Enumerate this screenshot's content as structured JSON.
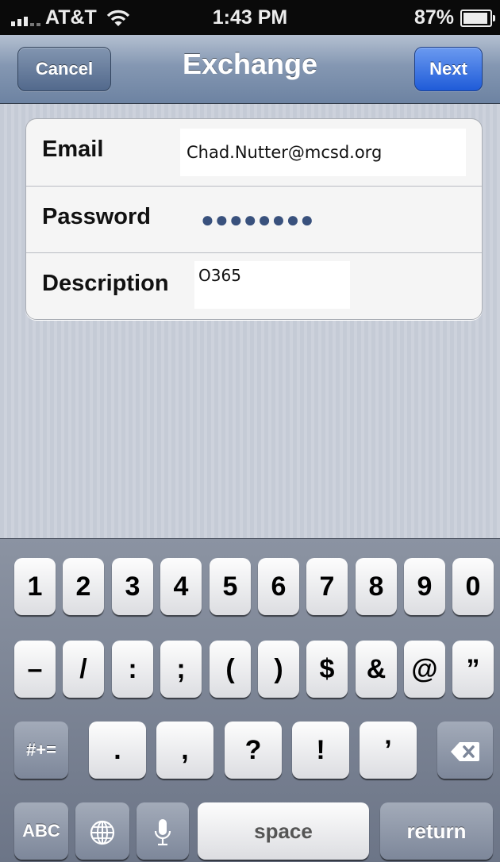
{
  "status_bar": {
    "carrier": "AT&T",
    "time": "1:43 PM",
    "battery_percent": "87%",
    "icons": [
      "signal-icon",
      "wifi-icon",
      "battery-icon"
    ]
  },
  "nav_bar": {
    "cancel_label": "Cancel",
    "title": "Exchange",
    "next_label": "Next"
  },
  "form": {
    "email_label": "Email",
    "email_value": "Chad.Nutter@mcsd.org",
    "password_label": "Password",
    "password_mask": "●●●●●●●●",
    "description_label": "Description",
    "description_value": "O365"
  },
  "keyboard": {
    "row1": [
      "1",
      "2",
      "3",
      "4",
      "5",
      "6",
      "7",
      "8",
      "9",
      "0"
    ],
    "row2": [
      "–",
      "/",
      ":",
      ";",
      "(",
      ")",
      "$",
      "&",
      "@",
      "”"
    ],
    "row3": {
      "shift_label": "#+=",
      "keys": [
        ".",
        ",",
        "?",
        "!",
        "’"
      ],
      "delete_icon": "delete-icon"
    },
    "row4": {
      "abc_label": "ABC",
      "globe_icon": "globe-icon",
      "mic_icon": "microphone-icon",
      "space_label": "space",
      "return_label": "return"
    }
  },
  "colors": {
    "navbar": "#7d90ab",
    "next_button": "#2a63de",
    "password_dots": "#39517d"
  }
}
